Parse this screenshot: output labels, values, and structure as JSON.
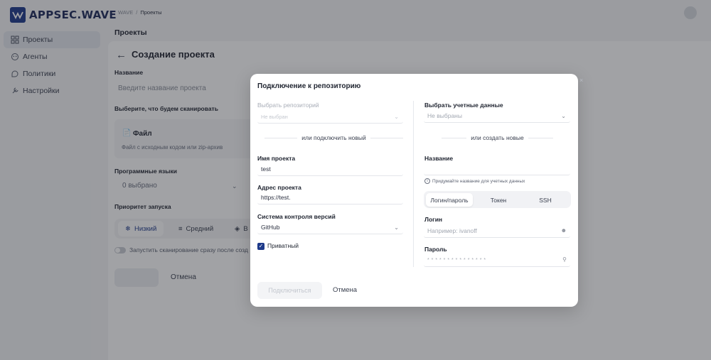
{
  "app": {
    "logo_text": "APPSEC.WAVE"
  },
  "sidebar": {
    "items": [
      {
        "label": "Проекты",
        "icon": "grid-icon"
      },
      {
        "label": "Агенты",
        "icon": "agent-icon"
      },
      {
        "label": "Политики",
        "icon": "policy-icon"
      },
      {
        "label": "Настройки",
        "icon": "gear-icon"
      }
    ]
  },
  "breadcrumb": {
    "root": "WAVE",
    "sep": "/",
    "current": "Проекты"
  },
  "page": {
    "title": "Проекты"
  },
  "form": {
    "heading": "Создание проекта",
    "name_label": "Название",
    "name_placeholder": "Введите название проекта",
    "scan_label": "Выберите, что будем сканировать",
    "file_title": "Файл",
    "file_desc": "Файл с исходным кодом или zip-архив",
    "langs_label": "Программные языки",
    "langs_value": "0 выбрано",
    "priority_label": "Приоритет запуска",
    "priority_low": "Низкий",
    "priority_mid": "Средний",
    "priority_high_partial": "В",
    "autostart": "Запустить сканирование сразу после созд",
    "cancel": "Отмена"
  },
  "modal": {
    "title": "Подключение к репозиторию",
    "left": {
      "repo_label": "Выбрать репозиторий",
      "repo_placeholder": "Не выбран",
      "or_connect": "или подключить новый",
      "project_name_label": "Имя проекта",
      "project_name_value": "test",
      "project_url_label": "Адрес проекта",
      "project_url_value": "https://test.",
      "vcs_label": "Система контроля версий",
      "vcs_value": "GitHub",
      "private_label": "Приватный"
    },
    "right": {
      "creds_label": "Выбрать учетные данные",
      "creds_placeholder": "Не выбраны",
      "or_create": "или создать новые",
      "name_label": "Название",
      "hint": "Придумайте название для учетных данных",
      "tabs": [
        "Логин/пароль",
        "Токен",
        "SSH"
      ],
      "login_label": "Логин",
      "login_placeholder": "Например: ivanoff",
      "password_label": "Пароль",
      "password_mask": "* * * * * * * * * * * * * * *"
    },
    "connect_button": "Подключиться",
    "cancel_button": "Отмена"
  }
}
